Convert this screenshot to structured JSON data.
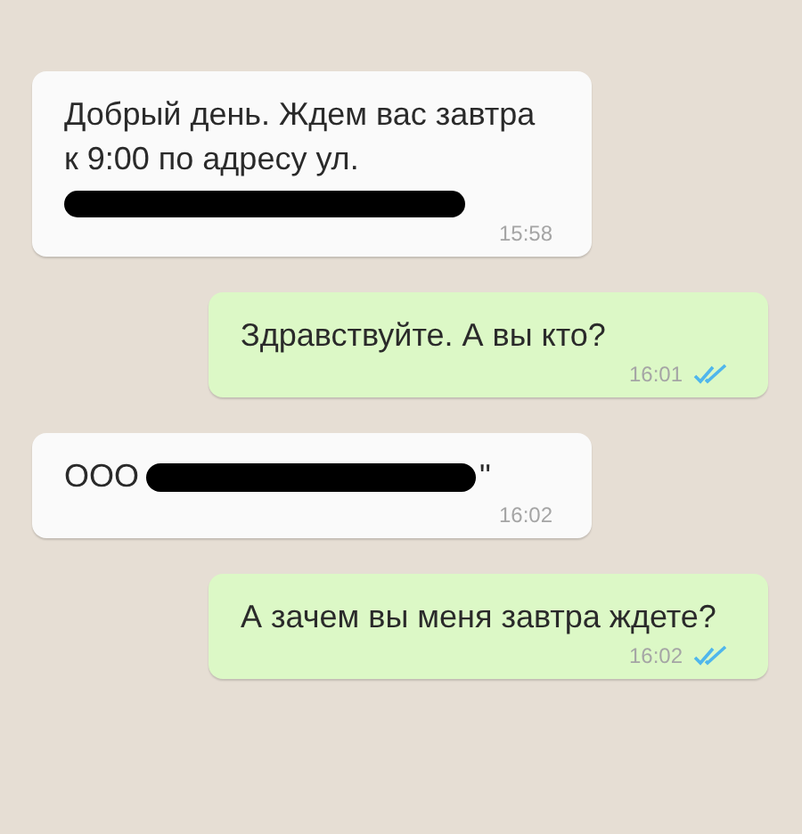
{
  "messages": [
    {
      "kind": "incoming",
      "parts": [
        {
          "kind": "text",
          "text": "Добрый день. Ждем вас завтра к 9:00 по адресу ул."
        },
        {
          "kind": "redaction",
          "block": true
        }
      ],
      "time": "15:58"
    },
    {
      "kind": "outgoing",
      "parts": [
        {
          "kind": "text",
          "text": "Здравствуйте. А вы кто?"
        }
      ],
      "time": "16:01",
      "read": true
    },
    {
      "kind": "incoming",
      "parts": [
        {
          "kind": "text",
          "text": "ООО"
        },
        {
          "kind": "redaction",
          "block": false
        },
        {
          "kind": "text",
          "text": "\""
        }
      ],
      "time": "16:02"
    },
    {
      "kind": "outgoing",
      "parts": [
        {
          "kind": "text",
          "text": "А зачем вы меня завтра ждете?"
        }
      ],
      "time": "16:02",
      "read": true
    }
  ]
}
